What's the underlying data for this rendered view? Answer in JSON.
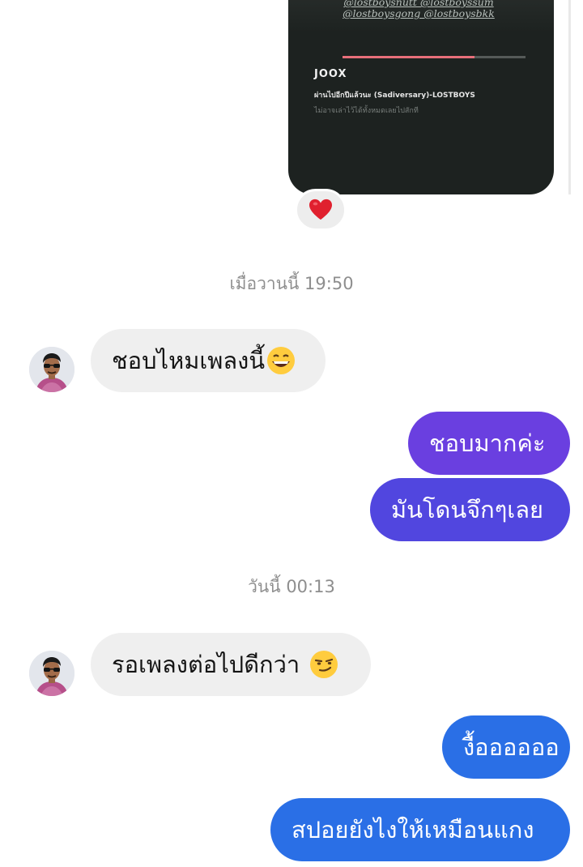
{
  "shared_card": {
    "handles_line1": "@lostboysnutt @lostboyssum",
    "handles_line2": "@lostboysgong @lostboysbkk",
    "brand": "JOOX",
    "song_title": "ผ่านไปอีกปีแล้วนะ (Sadiversary)-LOSTBOYS",
    "note": "ไม่อาจเล่าไว้ได้ทั้งหมดเลยไปสักที",
    "progress_fraction": 0.72
  },
  "reaction": {
    "icon": "heart-icon",
    "color": "#e0202e"
  },
  "conversation": {
    "timestamp_1": "เมื่อวานนี้ 19:50",
    "timestamp_2": "วันนี้ 00:13",
    "messages": [
      {
        "sender": "other",
        "text": "ชอบไหมเพลงนี้",
        "emoji": "grinning-face-icon"
      },
      {
        "sender": "me",
        "text": "ชอบมากค่ะ"
      },
      {
        "sender": "me",
        "text": "มันโดนจึกๆเลย"
      },
      {
        "sender": "other",
        "text": "รอเพลงต่อไปดีกว่า",
        "emoji": "smirking-face-icon"
      },
      {
        "sender": "me",
        "text": "งื้ออออออ"
      },
      {
        "sender": "me",
        "text": "สปอยยังไงให้เหมือนแกง"
      }
    ]
  },
  "colors": {
    "bubble_purple": "#6a3fe0",
    "bubble_violet": "#5146df",
    "bubble_blue": "#2a6fe6",
    "bubble_incoming": "#efefef"
  }
}
